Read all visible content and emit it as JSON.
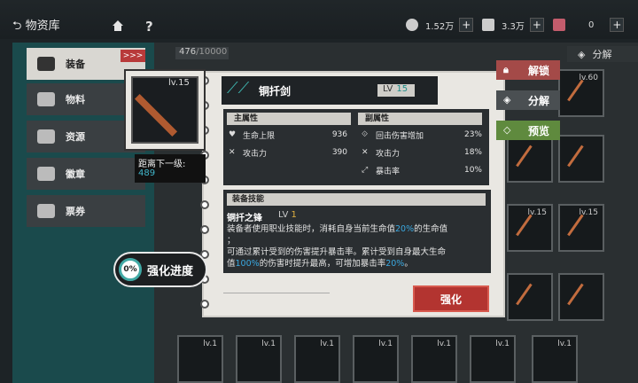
{
  "header": {
    "back_label": "物资库",
    "help": "?",
    "resources": [
      {
        "value": "1.52万",
        "plus": "+"
      },
      {
        "value": "3.3万",
        "plus": "+"
      },
      {
        "value": "0",
        "plus": "+"
      }
    ]
  },
  "sidebar": {
    "badge": ">>>",
    "items": [
      {
        "label": "装备"
      },
      {
        "label": "物料"
      },
      {
        "label": "资源"
      },
      {
        "label": "徽章"
      },
      {
        "label": "票券"
      }
    ]
  },
  "inventory": {
    "count": "476",
    "max": "/10000",
    "decompose_tab": "分解",
    "cells": [
      {
        "lv": "lv.60"
      },
      {
        "lv": ""
      },
      {
        "lv": "lv.15"
      },
      {
        "lv": "lv.15"
      },
      {
        "lv": "lv.1"
      },
      {
        "lv": "lv.1"
      },
      {
        "lv": "lv.1"
      },
      {
        "lv": "lv.1"
      },
      {
        "lv": "lv.1"
      },
      {
        "lv": "lv.1"
      },
      {
        "lv": "lv.1"
      }
    ]
  },
  "item": {
    "portrait_lv": "lv.15",
    "name": "铜扦剑",
    "lv_label": "LV",
    "lv_value": "15",
    "next_level_label": "距离下一级:",
    "next_level_value": "489",
    "progress_value": "0",
    "progress_unit": "%",
    "progress_label": "强化进度"
  },
  "stats": {
    "main_header": "主属性",
    "sub_header": "副属性",
    "main": [
      {
        "label": "生命上限",
        "value": "936"
      },
      {
        "label": "攻击力",
        "value": "390"
      }
    ],
    "sub": [
      {
        "label": "回击伤害增加",
        "value": "23%"
      },
      {
        "label": "攻击力",
        "value": "18%"
      },
      {
        "label": "暴击率",
        "value": "10%"
      }
    ]
  },
  "skill": {
    "header": "装备技能",
    "name": "铜扦之锋",
    "lv_label": "LV",
    "lv_value": "1",
    "line1a": "装备者使用职业技能时，消耗自身当前生命值",
    "line1b": "20%",
    "line1c": "的生命值",
    "line2": "；",
    "line3": "可通过累计受到的伤害提升暴击率。累计受到自身最大生命",
    "line4a": "值",
    "line4b": "100%",
    "line4c": "的伤害时提升最高，可增加暴击率",
    "line4d": "20%",
    "line4e": "。"
  },
  "actions": {
    "strengthen": "强化",
    "unlock": "解锁",
    "decompose": "分解",
    "preview": "预览"
  },
  "colors": {
    "accent_teal": "#3fb6b0",
    "highlight_blue": "#3aa8e0",
    "strengthen_red": "#b33430",
    "unlock_red": "#a44a48",
    "preview_green": "#5f8a3e"
  }
}
